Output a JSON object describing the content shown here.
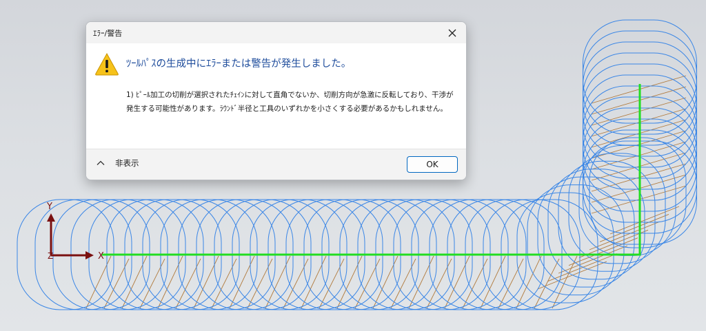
{
  "dialog": {
    "title": "ｴﾗｰ/警告",
    "close_icon": "close-icon",
    "main_icon": "warning-icon",
    "main_instruction": "ﾂｰﾙﾊﾟｽの生成中にｴﾗｰまたは警告が発生しました。",
    "message": "1) ﾋﾟｰﾙ加工の切削が選択されたﾁｪｲﾝに対して直角でないか、切削方向が急激に反転しており、干渉が発生する可能性があります。ﾗｳﾝﾄﾞ半径と工具のいずれかを小さくする必要があるかもしれません。",
    "collapse_label": "非表示",
    "collapse_icon": "chevron-up-icon",
    "ok_label": "OK"
  },
  "viewport": {
    "axis_x_label": "X",
    "axis_y_label": "Y",
    "axis_z_label": "Z",
    "colors": {
      "toolpath": "#3a86e6",
      "chain": "#22dd22",
      "link": "#b07a3c",
      "axis": "#7a1010"
    }
  }
}
